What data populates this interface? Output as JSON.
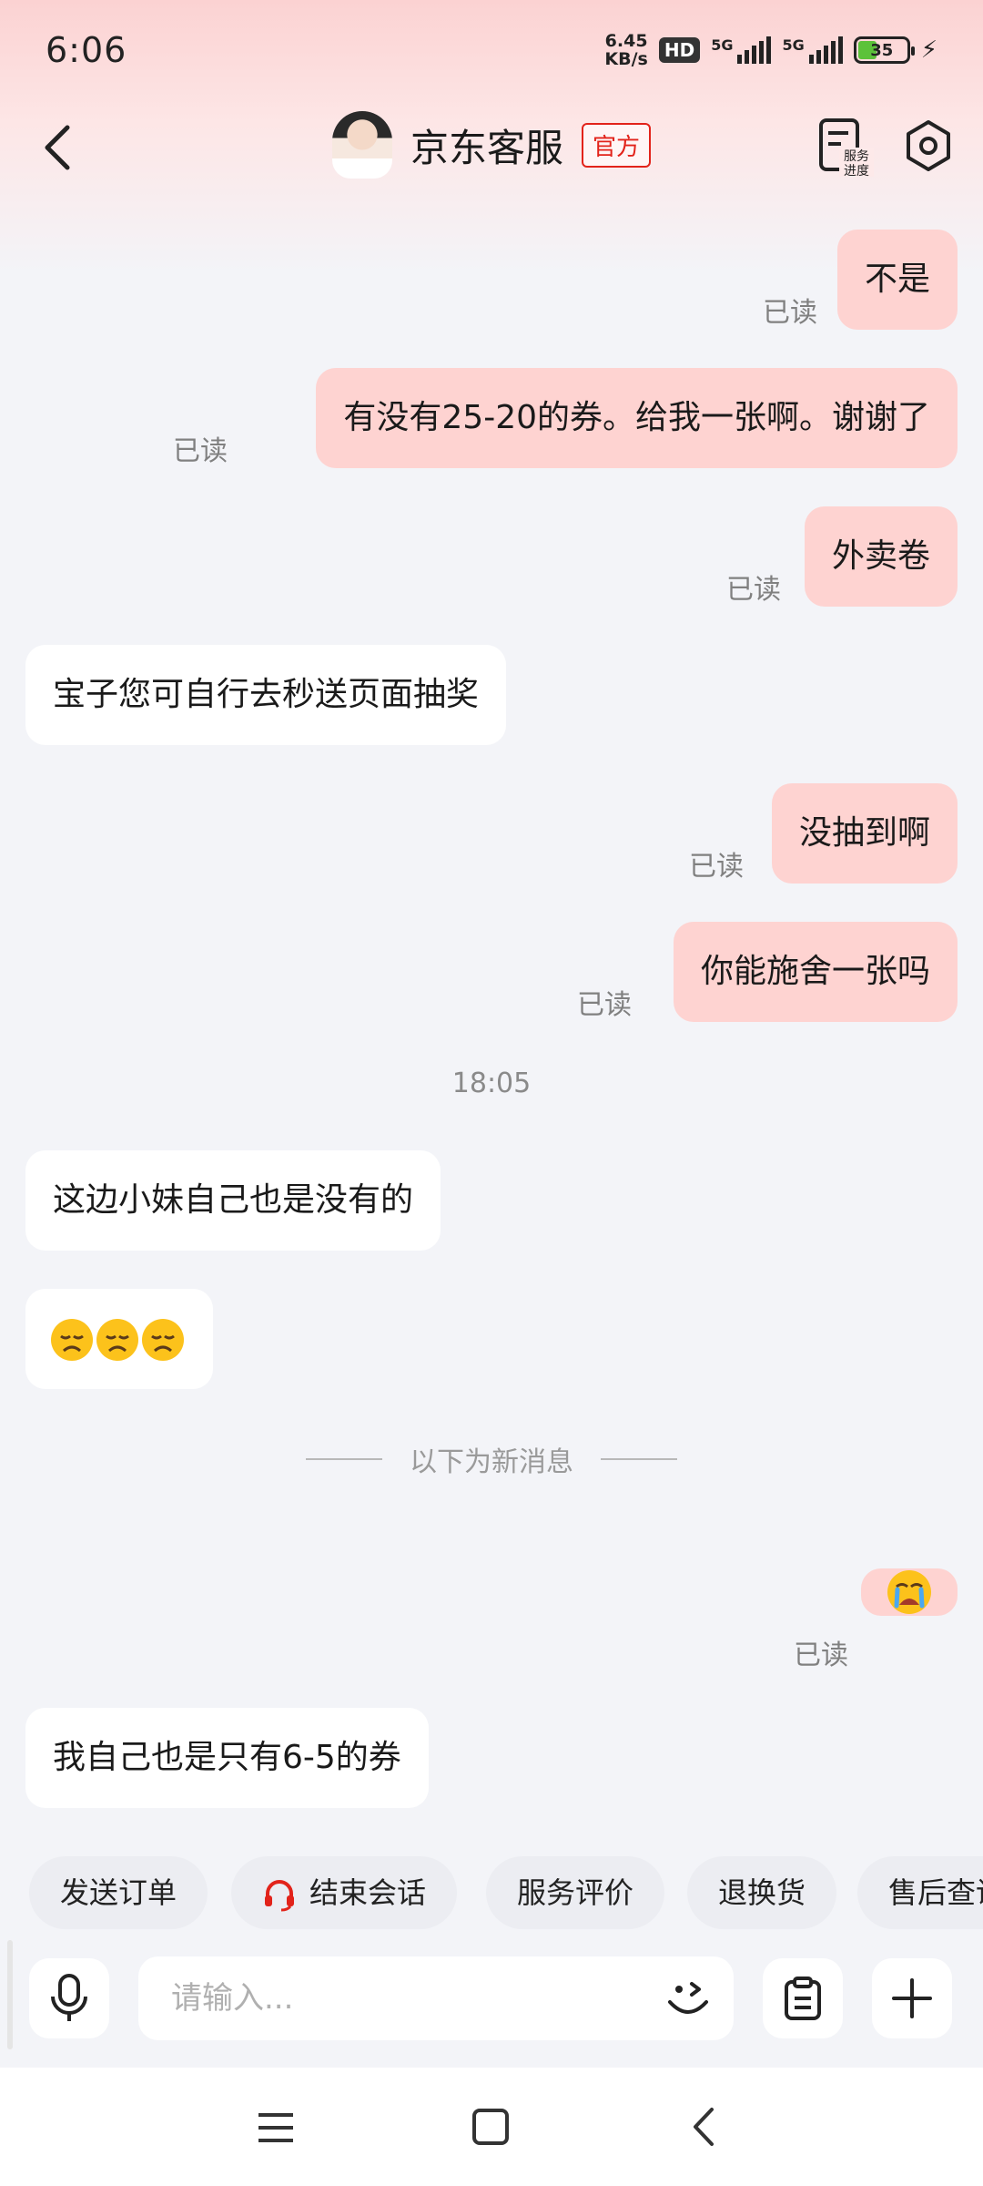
{
  "status_bar": {
    "time": "6:06",
    "net_speed_value": "6.45",
    "net_speed_unit": "KB/s",
    "hd_label": "HD",
    "signal1_label": "5G",
    "signal2_label": "5G",
    "battery": "35"
  },
  "header": {
    "title": "京东客服",
    "badge": "官方"
  },
  "messages": [
    {
      "side": "right",
      "text": "不是",
      "status": "已读"
    },
    {
      "side": "right",
      "text": "有没有25-20的券。给我一张啊。谢谢了",
      "status": "已读"
    },
    {
      "side": "right",
      "text": "外卖卷",
      "status": "已读"
    },
    {
      "side": "left",
      "text": "宝子您可自行去秒送页面抽奖"
    },
    {
      "side": "right",
      "text": "没抽到啊",
      "status": "已读"
    },
    {
      "side": "right",
      "text": "你能施舍一张吗",
      "status": "已读"
    },
    {
      "side": "left",
      "text": "这边小妹自己也是没有的"
    },
    {
      "side": "left",
      "emoji": "disappointed-face x3"
    },
    {
      "side": "right",
      "emoji": "crying-face",
      "status": "已读"
    },
    {
      "side": "left",
      "text": "我自己也是只有6-5的券"
    }
  ],
  "timestamp": "18:05",
  "new_messages_divider": "以下为新消息",
  "quick_actions": [
    "发送订单",
    "结束会话",
    "服务评价",
    "退换货",
    "售后查询"
  ],
  "input": {
    "placeholder": "请输入..."
  },
  "colors": {
    "accent_red": "#e2231a",
    "my_bubble": "#fed3d1",
    "their_bubble": "#ffffff",
    "background": "#f3f4f8"
  }
}
